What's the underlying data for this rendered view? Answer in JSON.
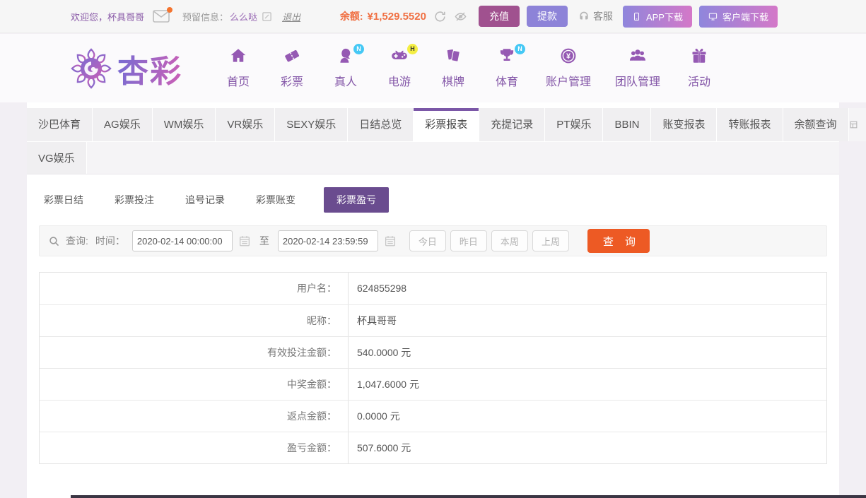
{
  "topbar": {
    "welcome_label": "欢迎您，",
    "username": "杯具哥哥",
    "reserved_label": "预留信息：",
    "reserved_value": "么么哒",
    "logout": "退出",
    "balance_label": "余额:",
    "balance_value": "¥1,529.5520",
    "deposit": "充值",
    "withdraw": "提款",
    "service": "客服",
    "app_download": "APP下载",
    "client_download": "客户端下载"
  },
  "header": {
    "logo_text": "杏彩",
    "nav": [
      {
        "label": "首页",
        "icon": "home-icon",
        "badge": ""
      },
      {
        "label": "彩票",
        "icon": "ticket-icon",
        "badge": ""
      },
      {
        "label": "真人",
        "icon": "live-person-icon",
        "badge": "N"
      },
      {
        "label": "电游",
        "icon": "gamepad-icon",
        "badge": "H"
      },
      {
        "label": "棋牌",
        "icon": "cards-icon",
        "badge": ""
      },
      {
        "label": "体育",
        "icon": "trophy-icon",
        "badge": "N"
      },
      {
        "label": "账户管理",
        "icon": "coin-icon",
        "badge": ""
      },
      {
        "label": "团队管理",
        "icon": "team-icon",
        "badge": ""
      },
      {
        "label": "活动",
        "icon": "gift-icon",
        "badge": ""
      }
    ]
  },
  "tabs": {
    "row1": [
      "沙巴体育",
      "AG娱乐",
      "WM娱乐",
      "VR娱乐",
      "SEXY娱乐",
      "日结总览",
      "彩票报表",
      "充提记录",
      "PT娱乐",
      "BBIN",
      "账变报表",
      "转账报表",
      "余额查询"
    ],
    "row2": [
      "VG娱乐"
    ],
    "active": "彩票报表"
  },
  "subtabs": {
    "items": [
      "彩票日结",
      "彩票投注",
      "追号记录",
      "彩票账变",
      "彩票盈亏"
    ],
    "active": "彩票盈亏"
  },
  "query": {
    "label": "查询:",
    "time_label": "时间：",
    "start_time": "2020-02-14 00:00:00",
    "to_label": "至",
    "end_time": "2020-02-14 23:59:59",
    "quick_buttons": [
      "今日",
      "昨日",
      "本周",
      "上周"
    ],
    "submit": "查 询"
  },
  "report": {
    "rows": [
      {
        "label": "用户名：",
        "value": "624855298"
      },
      {
        "label": "昵称：",
        "value": "杯具哥哥"
      },
      {
        "label": "有效投注金额：",
        "value": "540.0000 元"
      },
      {
        "label": "中奖金额：",
        "value": "1,047.6000 元"
      },
      {
        "label": "返点金额：",
        "value": "0.0000 元"
      },
      {
        "label": "盈亏金额：",
        "value": "507.6000 元"
      }
    ]
  },
  "colors": {
    "accent_purple": "#7b57a7",
    "nav_purple": "#8457a8",
    "balance_orange": "#f07043",
    "search_orange": "#ed5a24",
    "deposit_button": "#a0518f",
    "withdraw_button": "#8d83d8",
    "download_gradient_start": "#8f86dc",
    "download_gradient_end": "#d478c8",
    "subtab_active": "#6a4c8f",
    "badge_blue": "#45c8f5",
    "badge_yellow": "#f4ee43"
  }
}
